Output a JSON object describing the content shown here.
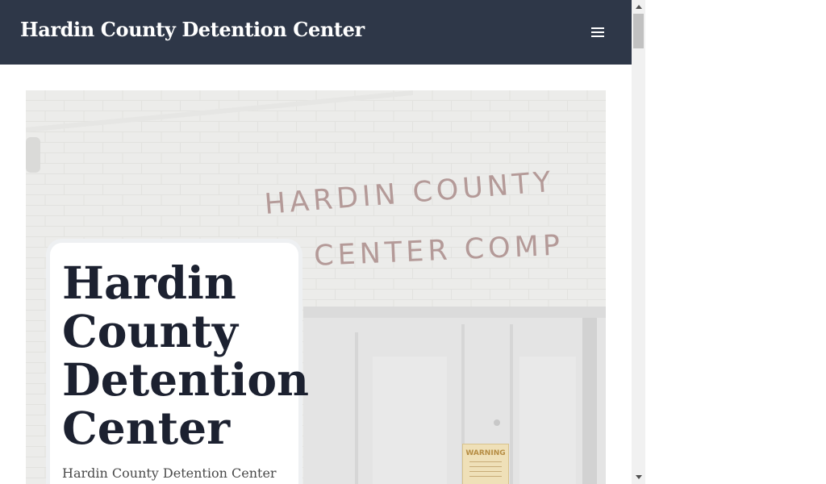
{
  "header": {
    "site_title": "Hardin County Detention Center",
    "menu_icon": "hamburger-menu-icon"
  },
  "hero": {
    "photo_sign_line1": "HARDIN COUNTY",
    "photo_sign_line2": "N CENTER COMP",
    "warning_sign": "WARNING",
    "heading": "Hardin County Detention Center",
    "subtitle": "Hardin County Detention Center"
  },
  "colors": {
    "header_bg": "#2e3748",
    "heading_text": "#1c2130",
    "card_border": "#eef0f2"
  }
}
